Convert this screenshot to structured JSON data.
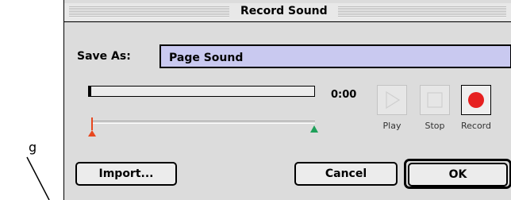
{
  "annotation": {
    "letter": "g"
  },
  "window": {
    "title": "Record Sound"
  },
  "save": {
    "label": "Save As:",
    "value": "Page Sound"
  },
  "playback": {
    "time": "0:00",
    "progress_fraction": 0.0,
    "play_label": "Play",
    "stop_label": "Stop",
    "record_label": "Record"
  },
  "buttons": {
    "import": "Import...",
    "cancel": "Cancel",
    "ok": "OK"
  },
  "colors": {
    "field_bg": "#c9c9f0",
    "record_dot": "#e62020",
    "start_marker": "#e8471e",
    "end_marker": "#1fa05a"
  }
}
